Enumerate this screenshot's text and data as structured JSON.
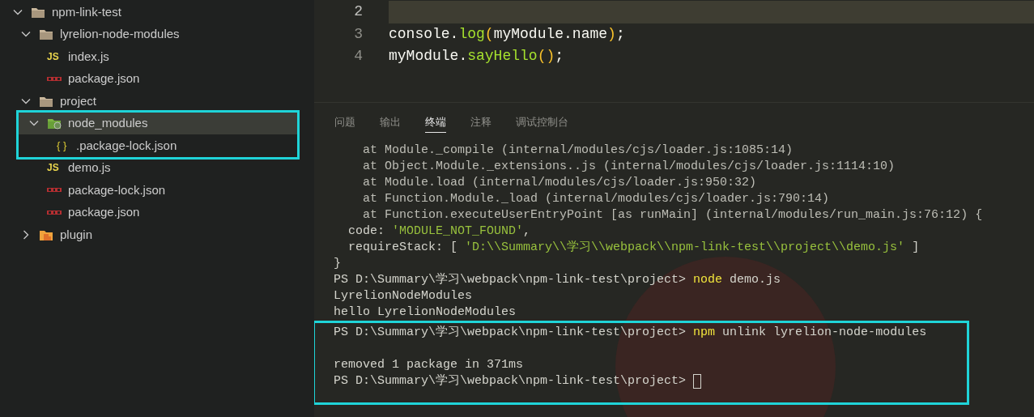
{
  "explorer": {
    "tree": [
      {
        "label": "npm-link-test",
        "kind": "folder",
        "expanded": true,
        "selected": false,
        "children": [
          {
            "label": "lyrelion-node-modules",
            "kind": "folder",
            "expanded": true,
            "selected": false,
            "children": [
              {
                "label": "index.js",
                "kind": "js",
                "badge": "JS",
                "selected": false
              },
              {
                "label": "package.json",
                "kind": "npm",
                "selected": false
              }
            ]
          },
          {
            "label": "project",
            "kind": "folder",
            "expanded": true,
            "selected": false,
            "children": [
              {
                "label": "node_modules",
                "kind": "node-folder",
                "expanded": true,
                "selected": true,
                "highlighted": true,
                "children": [
                  {
                    "label": ".package-lock.json",
                    "kind": "json",
                    "badge": "{ }",
                    "selected": false,
                    "highlighted": true
                  }
                ]
              },
              {
                "label": "demo.js",
                "kind": "js",
                "badge": "JS",
                "selected": false
              },
              {
                "label": "package-lock.json",
                "kind": "npm",
                "selected": false
              },
              {
                "label": "package.json",
                "kind": "npm",
                "selected": false
              }
            ]
          },
          {
            "label": "plugin",
            "kind": "plugin-folder",
            "expanded": false,
            "selected": false
          }
        ]
      }
    ]
  },
  "editor": {
    "lines": [
      {
        "number": "2",
        "current": true
      },
      {
        "number": "3",
        "current": false,
        "segments": [
          {
            "text": "console.",
            "kind": "plain"
          },
          {
            "text": "log",
            "kind": "method"
          },
          {
            "text": "(",
            "kind": "paren"
          },
          {
            "text": "myModule.name",
            "kind": "plain"
          },
          {
            "text": ")",
            "kind": "paren"
          },
          {
            "text": ";",
            "kind": "plain"
          }
        ]
      },
      {
        "number": "4",
        "current": false,
        "segments": [
          {
            "text": "myModule.",
            "kind": "plain"
          },
          {
            "text": "sayHello",
            "kind": "method"
          },
          {
            "text": "()",
            "kind": "paren"
          },
          {
            "text": ";",
            "kind": "plain"
          }
        ]
      }
    ]
  },
  "panel": {
    "tabs": [
      {
        "label": "问题",
        "selected": false
      },
      {
        "label": "输出",
        "selected": false
      },
      {
        "label": "终端",
        "selected": true
      },
      {
        "label": "注释",
        "selected": false
      },
      {
        "label": "调试控制台",
        "selected": false
      }
    ],
    "terminal": {
      "lines": [
        {
          "segments": [
            {
              "text": "    at Module._compile (internal/modules/cjs/loader.js:1085:14)",
              "kind": "dim"
            }
          ]
        },
        {
          "segments": [
            {
              "text": "    at Object.Module._extensions..js (internal/modules/cjs/loader.js:1114:10)",
              "kind": "dim"
            }
          ]
        },
        {
          "segments": [
            {
              "text": "    at Module.load (internal/modules/cjs/loader.js:950:32)",
              "kind": "dim"
            }
          ]
        },
        {
          "segments": [
            {
              "text": "    at Function.Module._load (internal/modules/cjs/loader.js:790:14)",
              "kind": "dim"
            }
          ]
        },
        {
          "segments": [
            {
              "text": "    at Function.executeUserEntryPoint [as runMain] (internal/modules/run_main.js:76:12) {",
              "kind": "dim"
            }
          ]
        },
        {
          "segments": [
            {
              "text": "  code: ",
              "kind": "text"
            },
            {
              "text": "'MODULE_NOT_FOUND'",
              "kind": "string"
            },
            {
              "text": ",",
              "kind": "text"
            }
          ]
        },
        {
          "segments": [
            {
              "text": "  requireStack: [ ",
              "kind": "text"
            },
            {
              "text": "'D:\\\\Summary\\\\学习\\\\webpack\\\\npm-link-test\\\\project\\\\demo.js'",
              "kind": "string"
            },
            {
              "text": " ]",
              "kind": "text"
            }
          ]
        },
        {
          "segments": [
            {
              "text": "}",
              "kind": "text"
            }
          ]
        },
        {
          "segments": [
            {
              "text": "PS D:\\Summary\\学习\\webpack\\npm-link-test\\project> ",
              "kind": "text"
            },
            {
              "text": "node",
              "kind": "command"
            },
            {
              "text": " demo.js",
              "kind": "text"
            }
          ]
        },
        {
          "segments": [
            {
              "text": "LyrelionNodeModules",
              "kind": "text"
            }
          ]
        },
        {
          "segments": [
            {
              "text": "hello LyrelionNodeModules",
              "kind": "text"
            }
          ]
        },
        {
          "highlighted": true,
          "segments": [
            {
              "text": "PS D:\\Summary\\学习\\webpack\\npm-link-test\\project> ",
              "kind": "text"
            },
            {
              "text": "npm",
              "kind": "command"
            },
            {
              "text": " unlink lyrelion-node-modules",
              "kind": "text"
            }
          ]
        },
        {
          "highlighted": true
        },
        {
          "highlighted": true,
          "segments": [
            {
              "text": "removed 1 package in 371ms",
              "kind": "text"
            }
          ]
        },
        {
          "highlighted": true,
          "cursor": true,
          "segments": [
            {
              "text": "PS D:\\Summary\\学习\\webpack\\npm-link-test\\project> ",
              "kind": "text"
            }
          ]
        }
      ]
    }
  }
}
